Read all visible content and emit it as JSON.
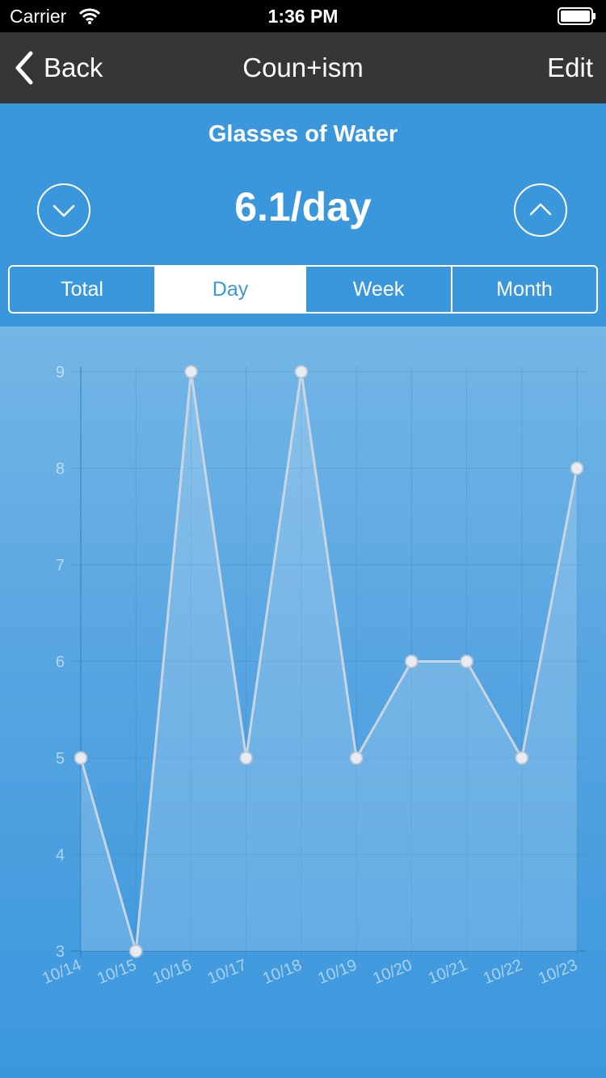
{
  "status_bar": {
    "carrier": "Carrier",
    "time": "1:36 PM"
  },
  "nav": {
    "back_label": "Back",
    "title": "Coun+ism",
    "edit_label": "Edit"
  },
  "counter": {
    "title": "Glasses of Water",
    "rate": "6.1/day"
  },
  "tabs": [
    {
      "label": "Total",
      "active": false
    },
    {
      "label": "Day",
      "active": true
    },
    {
      "label": "Week",
      "active": false
    },
    {
      "label": "Month",
      "active": false
    }
  ],
  "icons": {
    "back": "chevron-left-icon",
    "down": "chevron-down-icon",
    "up": "chevron-up-icon",
    "wifi": "wifi-icon",
    "battery": "battery-icon"
  },
  "colors": {
    "background": "#3a97dc",
    "nav": "#363636",
    "status": "#000000"
  },
  "chart_data": {
    "type": "area",
    "title": "",
    "x": [
      "10/14",
      "10/15",
      "10/16",
      "10/17",
      "10/18",
      "10/19",
      "10/20",
      "10/21",
      "10/22",
      "10/23"
    ],
    "series": [
      {
        "values": [
          5,
          3,
          9,
          5,
          9,
          5,
          6,
          6,
          5,
          8
        ]
      }
    ],
    "ylim": [
      3,
      9
    ],
    "yticks": [
      3,
      4,
      5,
      6,
      7,
      8,
      9
    ],
    "grid": true
  }
}
